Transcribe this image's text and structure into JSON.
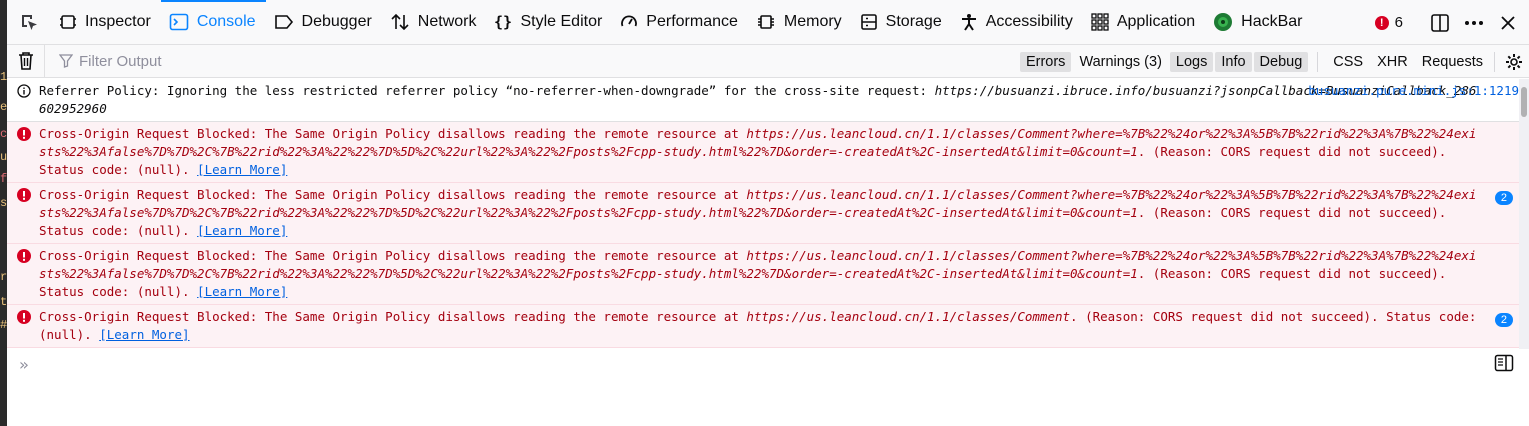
{
  "toolbar": {
    "tabs": [
      {
        "label": "Inspector",
        "icon": "inspector-icon"
      },
      {
        "label": "Console",
        "icon": "console-icon",
        "selected": true
      },
      {
        "label": "Debugger",
        "icon": "debugger-icon"
      },
      {
        "label": "Network",
        "icon": "network-icon"
      },
      {
        "label": "Style Editor",
        "icon": "style-editor-icon"
      },
      {
        "label": "Performance",
        "icon": "performance-icon"
      },
      {
        "label": "Memory",
        "icon": "memory-icon"
      },
      {
        "label": "Storage",
        "icon": "storage-icon"
      },
      {
        "label": "Accessibility",
        "icon": "accessibility-icon"
      },
      {
        "label": "Application",
        "icon": "application-icon"
      },
      {
        "label": "HackBar",
        "icon": "hackbar-icon"
      }
    ],
    "error_count": "6"
  },
  "filterbar": {
    "placeholder": "Filter Output",
    "levels": {
      "errors": "Errors",
      "warnings": "Warnings (3)",
      "logs": "Logs",
      "info": "Info",
      "debug": "Debug"
    },
    "types": {
      "css": "CSS",
      "xhr": "XHR",
      "requests": "Requests"
    }
  },
  "messages": [
    {
      "type": "log",
      "text": "Referrer Policy: Ignoring the less restricted referrer policy “no-referrer-when-downgrade” for the cross-site request: ",
      "url": "https://busuanzi.ibruce.info/busuanzi?jsonpCallback=BusuanziCallback_286602952960",
      "source": "busuanzi.pure.mini.js:1:1219"
    },
    {
      "type": "error",
      "text": "Cross-Origin Request Blocked: The Same Origin Policy disallows reading the remote resource at ",
      "url": "https://us.leancloud.cn/1.1/classes/Comment?where=%7B%22%24or%22%3A%5B%7B%22rid%22%3A%7B%22%24exists%22%3Afalse%7D%7D%2C%7B%22rid%22%3A%22%22%7D%5D%2C%22url%22%3A%22%2Fposts%2Fcpp-study.html%22%7D&order=-createdAt%2C-insertedAt&limit=0&count=1",
      "tail": ". (Reason: CORS request did not succeed). Status code: (null). ",
      "learn": "[Learn More]",
      "repeat": ""
    },
    {
      "type": "error",
      "text": "Cross-Origin Request Blocked: The Same Origin Policy disallows reading the remote resource at ",
      "url": "https://us.leancloud.cn/1.1/classes/Comment?where=%7B%22%24or%22%3A%5B%7B%22rid%22%3A%7B%22%24exists%22%3Afalse%7D%7D%2C%7B%22rid%22%3A%22%22%7D%5D%2C%22url%22%3A%22%2Fposts%2Fcpp-study.html%22%7D&order=-createdAt%2C-insertedAt&limit=0&count=1",
      "tail": ". (Reason: CORS request did not succeed). Status code: (null). ",
      "learn": "[Learn More]",
      "repeat": "2"
    },
    {
      "type": "error",
      "text": "Cross-Origin Request Blocked: The Same Origin Policy disallows reading the remote resource at ",
      "url": "https://us.leancloud.cn/1.1/classes/Comment?where=%7B%22%24or%22%3A%5B%7B%22rid%22%3A%7B%22%24exists%22%3Afalse%7D%7D%2C%7B%22rid%22%3A%22%22%7D%5D%2C%22url%22%3A%22%2Fposts%2Fcpp-study.html%22%7D&order=-createdAt%2C-insertedAt&limit=0&count=1",
      "tail": ". (Reason: CORS request did not succeed). Status code: (null). ",
      "learn": "[Learn More]",
      "repeat": ""
    },
    {
      "type": "error",
      "text": "Cross-Origin Request Blocked: The Same Origin Policy disallows reading the remote resource at ",
      "url": "https://us.leancloud.cn/1.1/classes/Comment",
      "tail": ". (Reason: CORS request did not succeed). Status code: (null). ",
      "learn": "[Learn More]",
      "repeat": "2"
    }
  ],
  "prompt": {
    "symbol": "»"
  },
  "colors": {
    "accent": "#0a84ff",
    "error_text": "#a4000f",
    "error_bg": "#fdf2f5",
    "error_icon": "#d70022",
    "link": "#0060df"
  }
}
